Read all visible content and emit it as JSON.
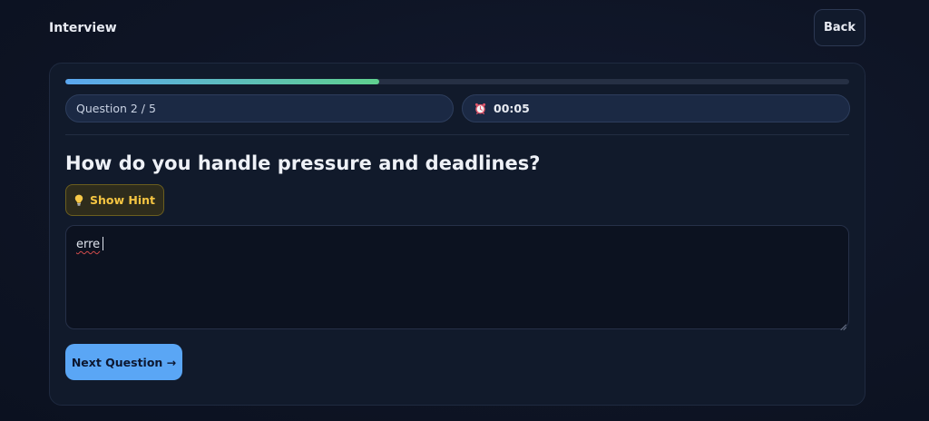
{
  "header": {
    "title": "Interview",
    "back_label": "Back"
  },
  "progress": {
    "fraction": 0.4,
    "colors": {
      "start": "#5ba7f0",
      "end": "#5fd08f"
    }
  },
  "status": {
    "question_counter": "Question 2 / 5",
    "timer": "00:05",
    "timer_icon": "alarm-clock-icon"
  },
  "question": {
    "text": "How do you handle pressure and deadlines?"
  },
  "hint": {
    "label": "Show Hint",
    "icon": "lightbulb-icon",
    "color": "#f5c542"
  },
  "answer": {
    "value": "erre"
  },
  "actions": {
    "next_label": "Next Question →",
    "accent": "#5aa6f5"
  }
}
